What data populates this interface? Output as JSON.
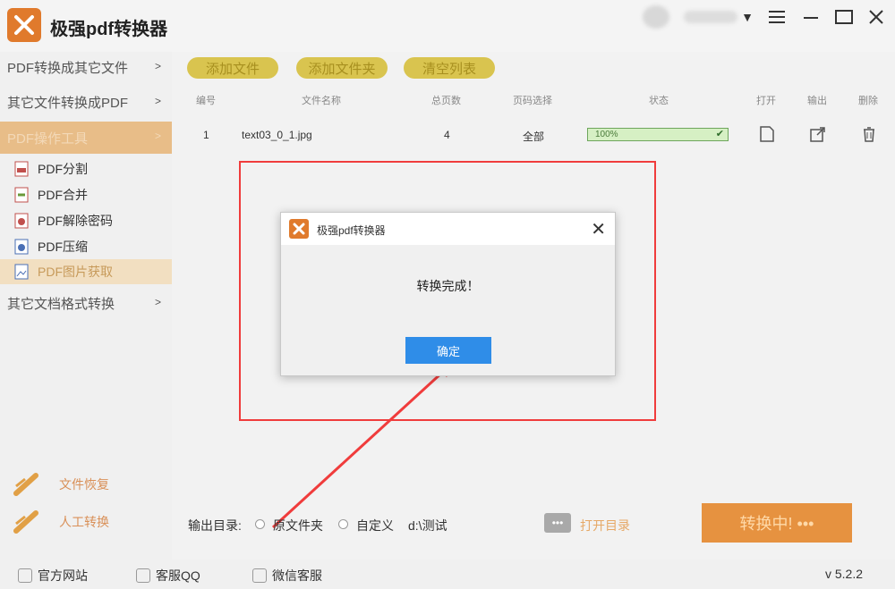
{
  "app": {
    "title": "极强pdf转换器"
  },
  "sidebar": {
    "groups": [
      {
        "label": "PDF转换成其它文件"
      },
      {
        "label": "其它文件转换成PDF"
      },
      {
        "label": "PDF操作工具"
      },
      {
        "label": "其它文档格式转换"
      }
    ],
    "items": [
      {
        "label": "PDF分割"
      },
      {
        "label": "PDF合并"
      },
      {
        "label": "PDF解除密码"
      },
      {
        "label": "PDF压缩"
      },
      {
        "label": "PDF图片获取"
      }
    ],
    "bottom": [
      {
        "label": "文件恢复"
      },
      {
        "label": "人工转换"
      }
    ]
  },
  "toolbar": {
    "add_file": "添加文件",
    "add_folder": "添加文件夹",
    "clear_list": "清空列表"
  },
  "table": {
    "headers": [
      "编号",
      "文件名称",
      "总页数",
      "页码选择",
      "状态",
      "打开",
      "输出",
      "删除"
    ],
    "rows": [
      {
        "index": "1",
        "name": "text03_0_1.jpg",
        "pages": "4",
        "range": "全部",
        "progress_label": "100%",
        "progress": 1.0
      }
    ]
  },
  "dialog": {
    "title": "极强pdf转换器",
    "message": "转换完成！",
    "ok": "确定"
  },
  "output": {
    "label": "输出目录:",
    "option_source": "原文件夹",
    "option_custom": "自定义",
    "path": "d:\\测试",
    "open_dir": "打开目录",
    "convert": "转换中! •••"
  },
  "footer": {
    "website": "官方网站",
    "qq": "客服QQ",
    "wechat": "微信客服",
    "version": "v 5.2.2"
  },
  "colors": {
    "accent": "#e69240",
    "red_highlight": "#f03c3c",
    "ok_button": "#2f8de8"
  }
}
